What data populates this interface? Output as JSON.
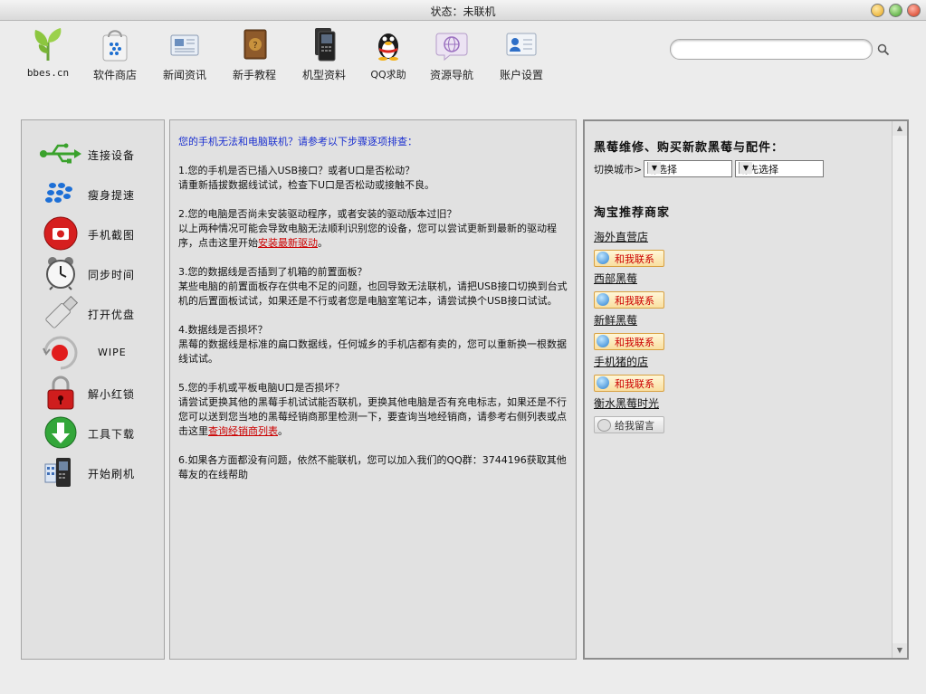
{
  "window": {
    "title": "状态：未联机"
  },
  "toolbar": {
    "items": [
      {
        "label": "bbes.cn",
        "icon": "sprout-icon"
      },
      {
        "label": "软件商店",
        "icon": "shopping-bag-icon"
      },
      {
        "label": "新闻资讯",
        "icon": "newspaper-icon"
      },
      {
        "label": "新手教程",
        "icon": "help-book-icon"
      },
      {
        "label": "机型资料",
        "icon": "phone-stack-icon"
      },
      {
        "label": "QQ求助",
        "icon": "qq-penguin-icon"
      },
      {
        "label": "资源导航",
        "icon": "globe-chat-icon"
      },
      {
        "label": "账户设置",
        "icon": "user-card-icon"
      }
    ],
    "search": {
      "value": "",
      "placeholder": ""
    }
  },
  "sidebar": {
    "items": [
      {
        "label": "连接设备",
        "icon": "usb-icon"
      },
      {
        "label": "瘦身提速",
        "icon": "blackberry-logo-icon"
      },
      {
        "label": "手机截图",
        "icon": "camera-icon"
      },
      {
        "label": "同步时间",
        "icon": "alarm-clock-icon"
      },
      {
        "label": "打开优盘",
        "icon": "usb-drive-icon"
      },
      {
        "label": "WIPE",
        "icon": "wipe-record-icon"
      },
      {
        "label": "解小红锁",
        "icon": "red-lock-icon"
      },
      {
        "label": "工具下载",
        "icon": "download-arrow-icon"
      },
      {
        "label": "开始刷机",
        "icon": "flash-phone-icon"
      }
    ]
  },
  "guide": {
    "intro": "您的手机无法和电脑联机？请参考以下步骤逐项排查：",
    "step1_title": "1.您的手机是否已插入USB接口？或者U口是否松动？",
    "step1_body": "请重新插拔数据线试试，检查下U口是否松动或接触不良。",
    "step2_title": "2.您的电脑是否尚未安装驱动程序，或者安装的驱动版本过旧？",
    "step2_body": "以上两种情况可能会导致电脑无法顺利识别您的设备，您可以尝试更新到最新的驱动程序，点击这里开始",
    "step2_link": "安装最新驱动",
    "step2_end": "。",
    "step3_title": "3.您的数据线是否插到了机箱的前置面板？",
    "step3_body": "某些电脑的前置面板存在供电不足的问题，也回导致无法联机，请把USB接口切换到台式机的后置面板试试，如果还是不行或者您是电脑室笔记本，请尝试换个USB接口试试。",
    "step4_title": "4.数据线是否损坏？",
    "step4_body": "黑莓的数据线是标准的扁口数据线，任何城乡的手机店都有卖的，您可以重新换一根数据线试试。",
    "step5_title": "5.您的手机或平板电脑U口是否损坏？",
    "step5_body": "请尝试更换其他的黑莓手机试试能否联机，更换其他电脑是否有充电标志，如果还是不行您可以送到您当地的黑莓经销商那里检测一下，要查询当地经销商，请参考右侧列表或点击这里",
    "step5_link": "查询经销商列表",
    "step5_end": "。",
    "step6": "6.如果各方面都没有问题，依然不能联机，您可以加入我们的QQ群：3744196获取其他莓友的在线帮助"
  },
  "dealers": {
    "heading": "黑莓维修、购买新款黑莓与配件：",
    "city_label": "切换城市>",
    "select1": "请选择",
    "select2": "请先选择",
    "taobao_heading": "淘宝推荐商家",
    "shops": [
      {
        "name": "海外直营店",
        "button": "和我联系"
      },
      {
        "name": "西部黑莓",
        "button": "和我联系"
      },
      {
        "name": "新鲜黑莓",
        "button": "和我联系"
      },
      {
        "name": "手机猪的店",
        "button": "和我联系"
      },
      {
        "name": "衡水黑莓时光",
        "button": "给我留言"
      }
    ]
  },
  "colors": {
    "intro_blue": "#1a2fd0",
    "link_red": "#cc0000",
    "panel_bg": "#e1e1e1"
  }
}
